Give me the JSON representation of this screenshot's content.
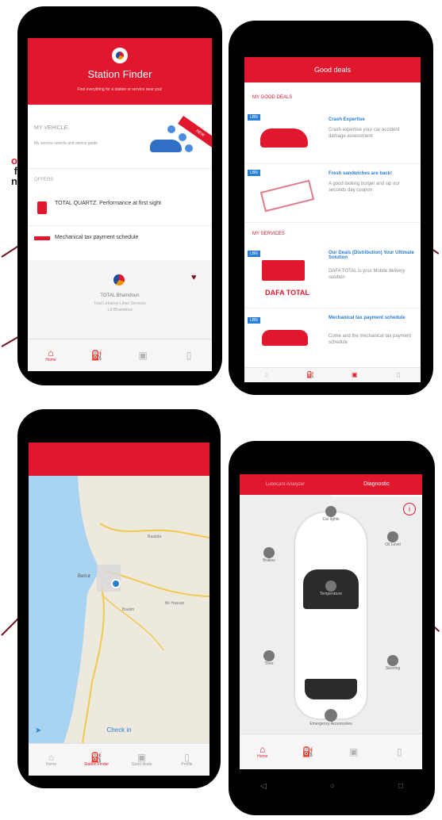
{
  "side_text": {
    "line1": "o",
    "line2": "f",
    "line3": "n"
  },
  "station_finder": {
    "title": "Station Finder",
    "subtitle": "Find everything for a station or service near you!",
    "vehicle_label": "MY VEHICLE",
    "vehicle_desc": "My service vehicle and advice guide",
    "new_badge": "NEW",
    "offers_label": "OFFERS",
    "offer1": "TOTAL QUARTZ. Performance at first sight",
    "offer2": "Mechanical tax payment schedule",
    "station_name": "TOTAL Bhamdoun",
    "station_line1": "Total Lebanon Liban Services",
    "station_line2": "1.8 Bhamdoun",
    "tabs": [
      "Home",
      "",
      "",
      ""
    ]
  },
  "good_deals": {
    "title": "Good deals",
    "section1": "MY GOOD DEALS",
    "section2": "MY SERVICES",
    "badge": "LBN",
    "deals": [
      {
        "title": "Crash Expertise",
        "desc": "Crash expertise your car accident damage assessment"
      },
      {
        "title": "Fresh sandwiches are back!",
        "desc": "A good looking burger and sip our seconds day coupon"
      },
      {
        "title": "Our Deals (Distribution) Your Ultimate Solution",
        "desc": "DAFA TOTAL is your Mobile delivery solution"
      },
      {
        "title": "Mechanical tax payment schedule",
        "desc": "Come and the mechanical tax payment schedule"
      }
    ],
    "truck_caption": "DAFA TOTAL"
  },
  "map_screen": {
    "city1": "Beirut",
    "city2": "Baabda",
    "city3": "Bir Hassan",
    "city4": "Bsalim",
    "check_in": "Check in",
    "tabs": [
      "Home",
      "Station Finder",
      "Good deals",
      "Profile"
    ]
  },
  "diagnostic": {
    "tab1": "Lubricant Analyzer",
    "tab2": "Diagnostic",
    "info_icon": "i",
    "parts": [
      "Car lights",
      "Brakes",
      "Oil Level",
      "Temperature",
      "Tires",
      "Steering",
      "Emergency Accessories"
    ],
    "tabs": [
      "Home",
      "",
      "",
      ""
    ]
  },
  "colors": {
    "brand_red": "#e0172d",
    "pointer": "#6e1422",
    "link_blue": "#2a7fd4"
  }
}
